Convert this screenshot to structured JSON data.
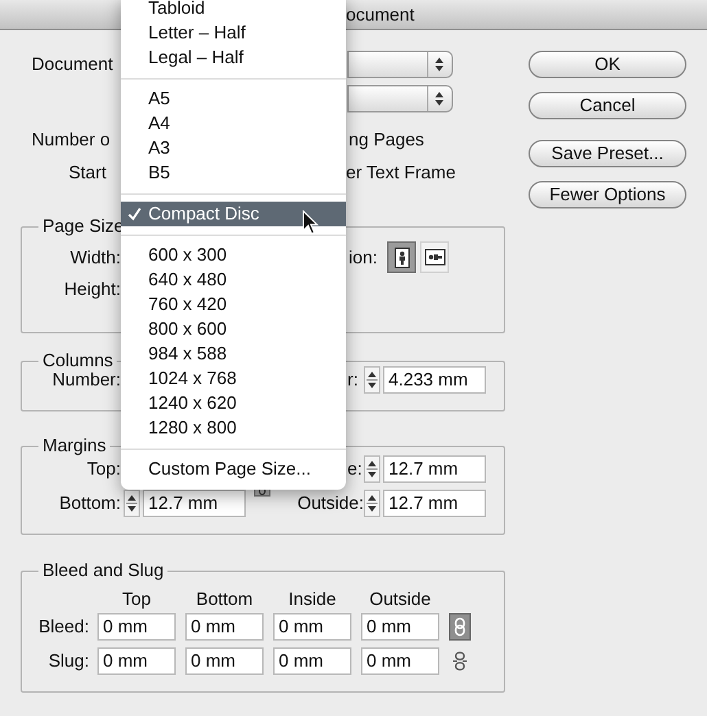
{
  "window": {
    "title": "ocument"
  },
  "preset": {
    "label": "Document"
  },
  "options": {
    "number_label": "Number o",
    "facing_pages_label": "ng Pages",
    "start_label": "Start",
    "master_text_frame_label": "er Text Frame"
  },
  "buttons": [
    "OK",
    "Cancel",
    "Save Preset...",
    "Fewer Options"
  ],
  "page_size": {
    "title": "Page Size",
    "width_label": "Width:",
    "height_label": "Height:",
    "orientation_label": "ion:",
    "orientation": [
      {
        "kind": "portrait",
        "selected": true
      },
      {
        "kind": "landscape",
        "selected": false
      }
    ]
  },
  "columns": {
    "title": "Columns",
    "number_label": "Number:",
    "gutter_label": "r:",
    "gutter_value": "4.233 mm"
  },
  "margins": {
    "title": "Margins",
    "top_label": "Top:",
    "inside_label": "e:",
    "inside_value": "12.7 mm",
    "bottom_label": "Bottom:",
    "bottom_value": "12.7 mm",
    "outside_label": "Outside:",
    "outside_value": "12.7 mm"
  },
  "bleed_and_slug": {
    "title": "Bleed and Slug",
    "columns": [
      "Top",
      "Bottom",
      "Inside",
      "Outside"
    ],
    "rows": [
      {
        "label": "Bleed:",
        "values": [
          "0 mm",
          "0 mm",
          "0 mm",
          "0 mm"
        ],
        "linked": true
      },
      {
        "label": "Slug:",
        "values": [
          "0 mm",
          "0 mm",
          "0 mm",
          "0 mm"
        ],
        "linked": false
      }
    ]
  },
  "page_size_menu": {
    "items": [
      {
        "kind": "item",
        "label": "Tabloid",
        "selected": false
      },
      {
        "kind": "item",
        "label": "Letter – Half",
        "selected": false
      },
      {
        "kind": "item",
        "label": "Legal – Half",
        "selected": false
      },
      {
        "kind": "separator"
      },
      {
        "kind": "item",
        "label": "A5",
        "selected": false
      },
      {
        "kind": "item",
        "label": "A4",
        "selected": false
      },
      {
        "kind": "item",
        "label": "A3",
        "selected": false
      },
      {
        "kind": "item",
        "label": "B5",
        "selected": false
      },
      {
        "kind": "separator"
      },
      {
        "kind": "item",
        "label": "Compact Disc",
        "selected": true
      },
      {
        "kind": "separator"
      },
      {
        "kind": "item",
        "label": "600 x 300",
        "selected": false
      },
      {
        "kind": "item",
        "label": "640 x 480",
        "selected": false
      },
      {
        "kind": "item",
        "label": "760 x 420",
        "selected": false
      },
      {
        "kind": "item",
        "label": "800 x 600",
        "selected": false
      },
      {
        "kind": "item",
        "label": "984 x 588",
        "selected": false
      },
      {
        "kind": "item",
        "label": "1024 x 768",
        "selected": false
      },
      {
        "kind": "item",
        "label": "1240 x 620",
        "selected": false
      },
      {
        "kind": "item",
        "label": "1280 x 800",
        "selected": false
      },
      {
        "kind": "separator"
      },
      {
        "kind": "item",
        "label": "Custom Page Size...",
        "selected": false
      }
    ]
  }
}
